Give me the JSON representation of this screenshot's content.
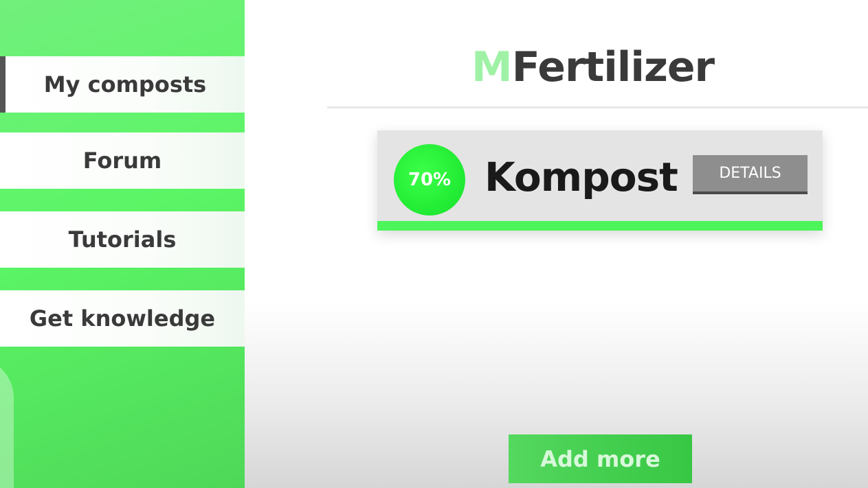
{
  "app": {
    "title_accent": "M",
    "title_rest": "Fertilizer"
  },
  "sidebar": {
    "items": [
      {
        "label": "My composts",
        "active": true
      },
      {
        "label": "Forum",
        "active": false
      },
      {
        "label": "Tutorials",
        "active": false
      },
      {
        "label": "Get knowledge",
        "active": false
      }
    ]
  },
  "composts": [
    {
      "progress_label": "70%",
      "progress": 0.7,
      "name": "Kompost",
      "details_label": "DETAILS"
    }
  ],
  "actions": {
    "add_more_label": "Add more"
  },
  "colors": {
    "accent_green": "#4cf55a",
    "badge_green": "#20ea33",
    "title_accent": "#9ff2a5",
    "details_gray": "#8e8e8e"
  }
}
